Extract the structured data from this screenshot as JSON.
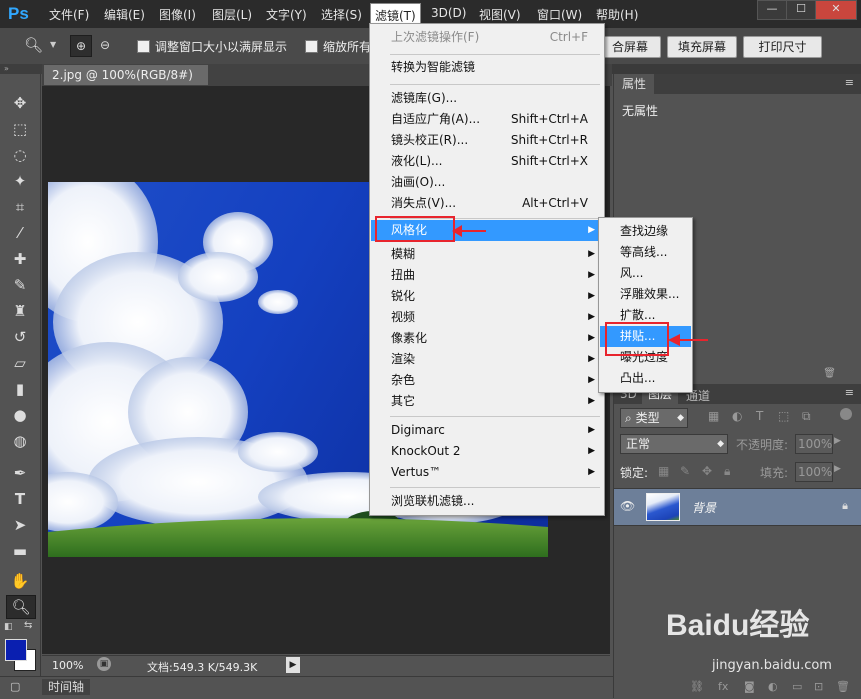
{
  "app": {
    "logo": "Ps"
  },
  "menubar": {
    "items": [
      "文件(F)",
      "编辑(E)",
      "图像(I)",
      "图层(L)",
      "文字(Y)",
      "选择(S)",
      "滤镜(T)",
      "3D(D)",
      "视图(V)",
      "窗口(W)",
      "帮助(H)"
    ],
    "active": "滤镜(T)"
  },
  "window_controls": {
    "minimize": "—",
    "maximize": "☐",
    "close": "✕"
  },
  "options_bar": {
    "resize_windows_label": "调整窗口大小以满屏显示",
    "zoom_all_label": "缩放所有",
    "fit_screen_label": "合屏幕",
    "fill_screen_label": "填充屏幕",
    "print_size_label": "打印尺寸"
  },
  "document": {
    "tab_title": "2.jpg @ 100%(RGB/8#)",
    "zoom": "100%",
    "doc_info": "文档:549.3 K/549.3K"
  },
  "timeline": {
    "label": "时间轴"
  },
  "filter_menu": {
    "items": [
      {
        "label": "上次滤镜操作(F)",
        "shortcut": "Ctrl+F",
        "disabled": true
      },
      {
        "label": "转换为智能滤镜"
      },
      {
        "label": "滤镜库(G)..."
      },
      {
        "label": "自适应广角(A)...",
        "shortcut": "Shift+Ctrl+A"
      },
      {
        "label": "镜头校正(R)...",
        "shortcut": "Shift+Ctrl+R"
      },
      {
        "label": "液化(L)...",
        "shortcut": "Shift+Ctrl+X"
      },
      {
        "label": "油画(O)..."
      },
      {
        "label": "消失点(V)...",
        "shortcut": "Alt+Ctrl+V"
      },
      {
        "label": "风格化",
        "submenu": true,
        "highlighted": true
      },
      {
        "label": "模糊",
        "submenu": true
      },
      {
        "label": "扭曲",
        "submenu": true
      },
      {
        "label": "锐化",
        "submenu": true
      },
      {
        "label": "视频",
        "submenu": true
      },
      {
        "label": "像素化",
        "submenu": true
      },
      {
        "label": "渲染",
        "submenu": true
      },
      {
        "label": "杂色",
        "submenu": true
      },
      {
        "label": "其它",
        "submenu": true
      },
      {
        "label": "Digimarc",
        "submenu": true
      },
      {
        "label": "KnockOut 2",
        "submenu": true
      },
      {
        "label": "Vertus™",
        "submenu": true
      },
      {
        "label": "浏览联机滤镜..."
      }
    ]
  },
  "stylize_submenu": {
    "items": [
      {
        "label": "查找边缘"
      },
      {
        "label": "等高线..."
      },
      {
        "label": "风..."
      },
      {
        "label": "浮雕效果..."
      },
      {
        "label": "扩散..."
      },
      {
        "label": "拼贴...",
        "highlighted": true
      },
      {
        "label": "曝光过度"
      },
      {
        "label": "凸出..."
      }
    ]
  },
  "properties_panel": {
    "tab": "属性",
    "empty_text": "无属性"
  },
  "layers_panel": {
    "tabs": [
      "3D",
      "图层",
      "通道"
    ],
    "active_tab": "图层",
    "filter_kind": "类型",
    "blend_mode": "正常",
    "opacity_label": "不透明度:",
    "opacity_value": "100%",
    "lock_label": "锁定:",
    "fill_label": "填充:",
    "fill_value": "100%",
    "layer": {
      "name": "背景"
    }
  },
  "watermark": {
    "brand": "Baidu经验",
    "url": "jingyan.baidu.com"
  },
  "colors": {
    "menu_highlight": "#3399ff",
    "annotation_red": "#e8242d",
    "foreground": "#0a1fb0",
    "background": "#ffffff"
  }
}
